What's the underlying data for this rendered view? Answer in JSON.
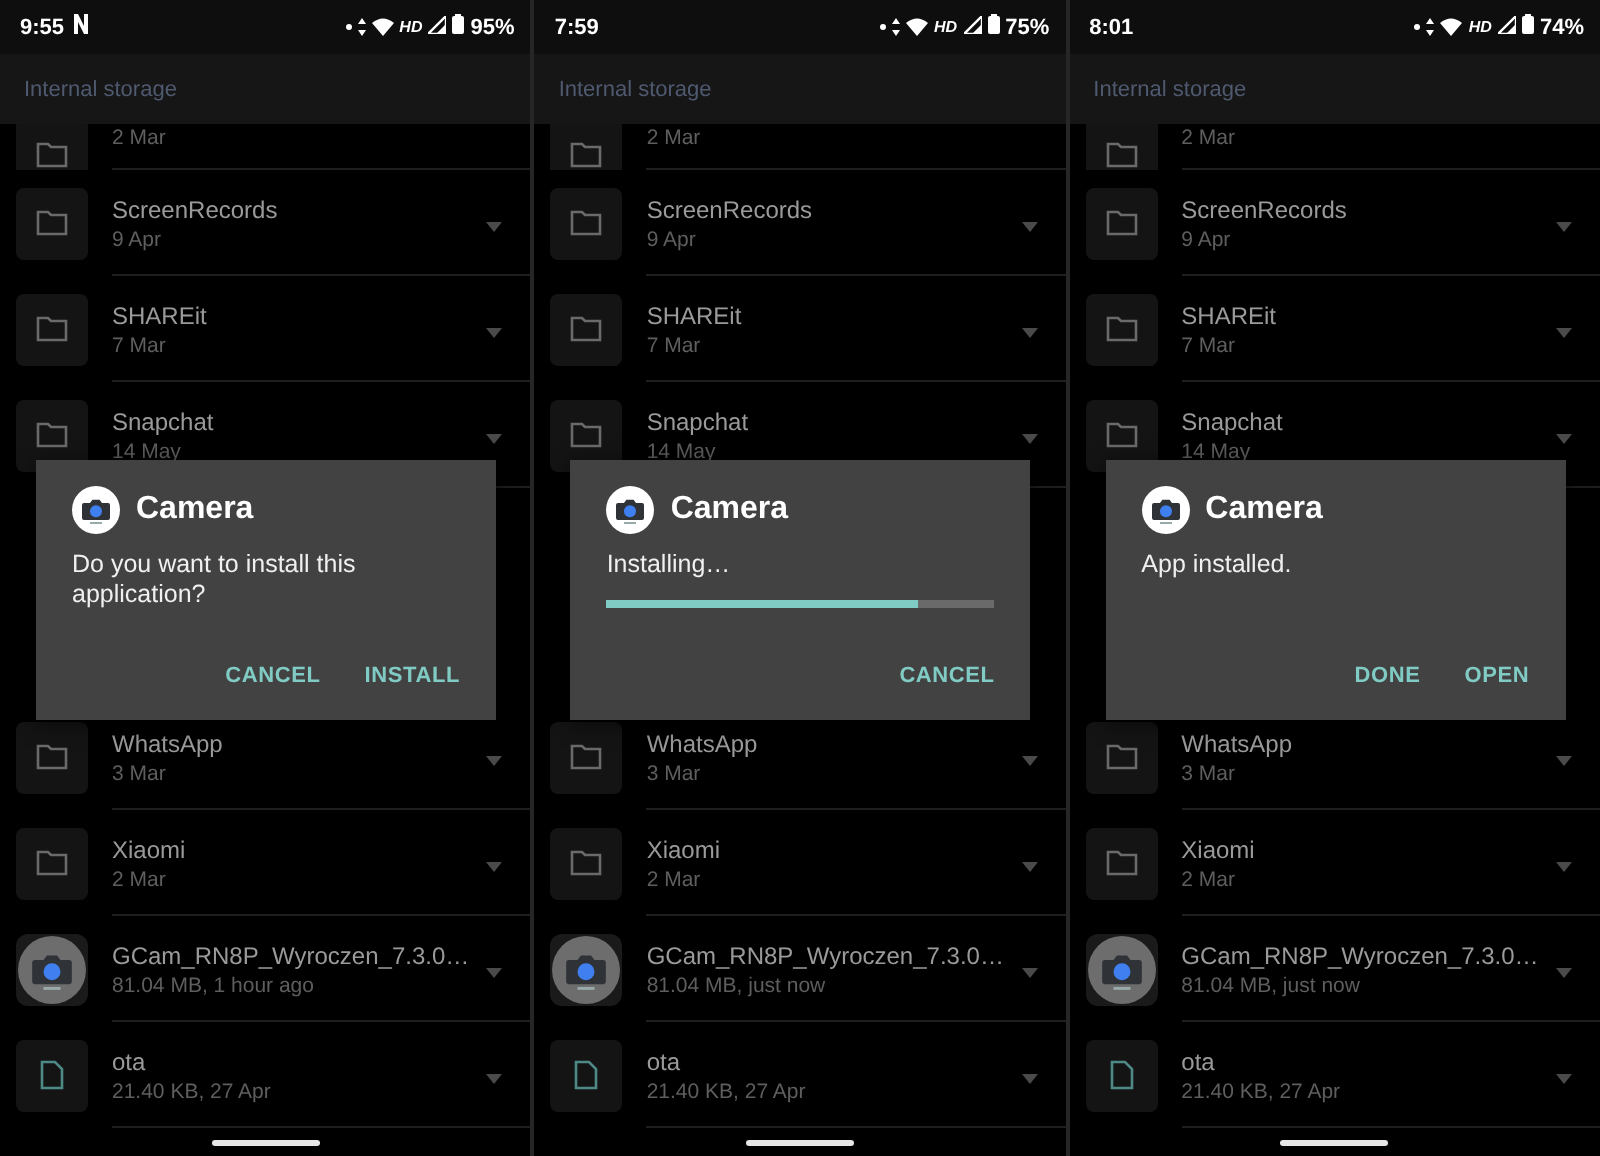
{
  "screens": [
    {
      "status": {
        "time": "9:55",
        "app_notification": true,
        "network": "HD",
        "battery": "95%"
      },
      "app_bar": {
        "title": "Internal storage"
      },
      "top_rows": [
        {
          "kind": "folder",
          "date": "2 Mar"
        },
        {
          "kind": "folder",
          "name": "ScreenRecords",
          "date": "9 Apr"
        },
        {
          "kind": "folder",
          "name": "SHAREit",
          "date": "7 Mar"
        },
        {
          "kind": "folder",
          "name": "Snapchat",
          "date": "14 May"
        }
      ],
      "bottom_rows": [
        {
          "kind": "folder",
          "name": "WhatsApp",
          "date": "3 Mar"
        },
        {
          "kind": "folder",
          "name": "Xiaomi",
          "date": "2 Mar"
        },
        {
          "kind": "apk",
          "name": "GCam_RN8P_Wyroczen_7.3.0…",
          "date": "81.04 MB, 1 hour ago"
        },
        {
          "kind": "file",
          "name": "ota",
          "date": "21.40 KB, 27 Apr"
        }
      ],
      "dialog": {
        "title": "Camera",
        "message": "Do you want to install this application?",
        "buttons": [
          "CANCEL",
          "INSTALL"
        ]
      }
    },
    {
      "status": {
        "time": "7:59",
        "app_notification": false,
        "network": "HD",
        "battery": "75%"
      },
      "app_bar": {
        "title": "Internal storage"
      },
      "top_rows": [
        {
          "kind": "folder",
          "date": "2 Mar"
        },
        {
          "kind": "folder",
          "name": "ScreenRecords",
          "date": "9 Apr"
        },
        {
          "kind": "folder",
          "name": "SHAREit",
          "date": "7 Mar"
        },
        {
          "kind": "folder",
          "name": "Snapchat",
          "date": "14 May"
        }
      ],
      "bottom_rows": [
        {
          "kind": "folder",
          "name": "WhatsApp",
          "date": "3 Mar"
        },
        {
          "kind": "folder",
          "name": "Xiaomi",
          "date": "2 Mar"
        },
        {
          "kind": "apk",
          "name": "GCam_RN8P_Wyroczen_7.3.0…",
          "date": "81.04 MB, just now"
        },
        {
          "kind": "file",
          "name": "ota",
          "date": "21.40 KB, 27 Apr"
        }
      ],
      "dialog": {
        "title": "Camera",
        "message": "Installing…",
        "level": 0.8,
        "buttons": [
          "CANCEL"
        ]
      }
    },
    {
      "status": {
        "time": "8:01",
        "app_notification": false,
        "network": "HD",
        "battery": "74%"
      },
      "app_bar": {
        "title": "Internal storage"
      },
      "top_rows": [
        {
          "kind": "folder",
          "date": "2 Mar"
        },
        {
          "kind": "folder",
          "name": "ScreenRecords",
          "date": "9 Apr"
        },
        {
          "kind": "folder",
          "name": "SHAREit",
          "date": "7 Mar"
        },
        {
          "kind": "folder",
          "name": "Snapchat",
          "date": "14 May"
        }
      ],
      "bottom_rows": [
        {
          "kind": "folder",
          "name": "WhatsApp",
          "date": "3 Mar"
        },
        {
          "kind": "folder",
          "name": "Xiaomi",
          "date": "2 Mar"
        },
        {
          "kind": "apk",
          "name": "GCam_RN8P_Wyroczen_7.3.0…",
          "date": "81.04 MB, just now"
        },
        {
          "kind": "file",
          "name": "ota",
          "date": "21.40 KB, 27 Apr"
        }
      ],
      "dialog": {
        "title": "Camera",
        "message": "App installed.",
        "buttons": [
          "DONE",
          "OPEN"
        ]
      }
    }
  ]
}
